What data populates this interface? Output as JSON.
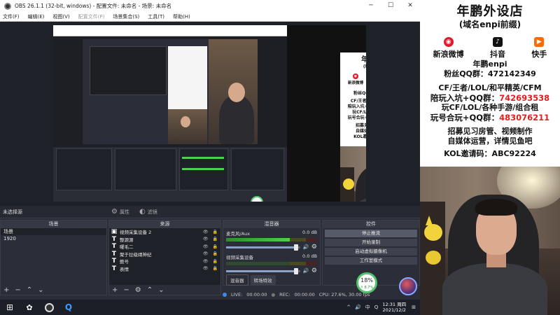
{
  "obs": {
    "window_title": "OBS 26.1.1 (32-bit, windows) - 配置文件: 未命名 - 场景: 未命名",
    "win_min": "─",
    "win_max": "☐",
    "win_close": "✕",
    "menu": [
      "文件(F)",
      "编辑(E)",
      "视图(V)",
      "配置文件(P)",
      "场景集合(S)",
      "工具(T)",
      "帮助(H)"
    ],
    "no_source": "未选择源",
    "props_btn": "属性",
    "filters_btn": "滤镜",
    "docks": {
      "scenes": {
        "title": "场景",
        "items": [
          "场景",
          "1920"
        ]
      },
      "sources": {
        "title": "来源",
        "items": [
          {
            "icon": "camera-icon",
            "glyph": "▣",
            "name": "视频采集设备 2"
          },
          {
            "icon": "text-icon",
            "glyph": "T",
            "name": "整源源"
          },
          {
            "icon": "text-icon",
            "glyph": "T",
            "name": "曜毛二"
          },
          {
            "icon": "text-icon",
            "glyph": "T",
            "name": "聚于拉级靖神纪"
          },
          {
            "icon": "text-icon",
            "glyph": "T",
            "name": "鲍号"
          },
          {
            "icon": "text-icon",
            "glyph": "T",
            "name": "表情"
          }
        ]
      },
      "mixer": {
        "title": "混音器",
        "channels": [
          {
            "name": "麦克风/Aux",
            "db": "0.0 dB"
          },
          {
            "name": "视频采集设备",
            "db": "0.0 dB"
          }
        ],
        "tab_mixer": "混音器",
        "tab_transitions": "转场特效"
      },
      "controls": {
        "title": "控件",
        "buttons": [
          "停止推流",
          "开始录制",
          "启动虚拟摄像机",
          "工作室模式"
        ]
      }
    },
    "status": {
      "live_label": "LIVE:",
      "live_time": "00:00:00",
      "rec_label": "REC:",
      "rec_time": "00:00:00",
      "cpu": "CPU: 27.6%, 30.00 fps"
    },
    "cpu_widget": {
      "value": "18%",
      "sub": "↑ 8.7%"
    }
  },
  "panel": {
    "title": "年鹏外设店",
    "subtitle": "(域名enpi前缀)",
    "platforms": [
      {
        "icon": "weibo-icon",
        "glyph": "◉",
        "label": "新浪微博"
      },
      {
        "icon": "douyin-icon",
        "glyph": "♪",
        "label": "抖音"
      },
      {
        "icon": "kuaishou-icon",
        "glyph": "▶",
        "label": "快手"
      }
    ],
    "name_line": "年鹏enpi",
    "fans_line": "粉丝QQ群：472142349",
    "games_line": "CF/王者/LOL/和平精英/CFM",
    "group1_prefix": "陪玩入坑+QQ群：",
    "group1_num": "742693538",
    "games_line2": "玩CF/LOL/各种手游/组合租",
    "group2_prefix": "玩号合玩+QQ群：",
    "group2_num": "483076211",
    "recruit1": "招募见习房管、视频制作",
    "recruit2": "自媒体运营，详情见鱼吧",
    "kol": "KOL邀请码：ABC92224"
  },
  "taskbar": {
    "time": "12:31 周四",
    "date": "2021/12/2",
    "tray": [
      "^",
      "🔊",
      "中",
      "Q",
      "⊞"
    ]
  },
  "colors": {
    "obs_bg": "#2b2e38",
    "accent_red": "#e02020",
    "meter_green": "#4fcf4f"
  }
}
